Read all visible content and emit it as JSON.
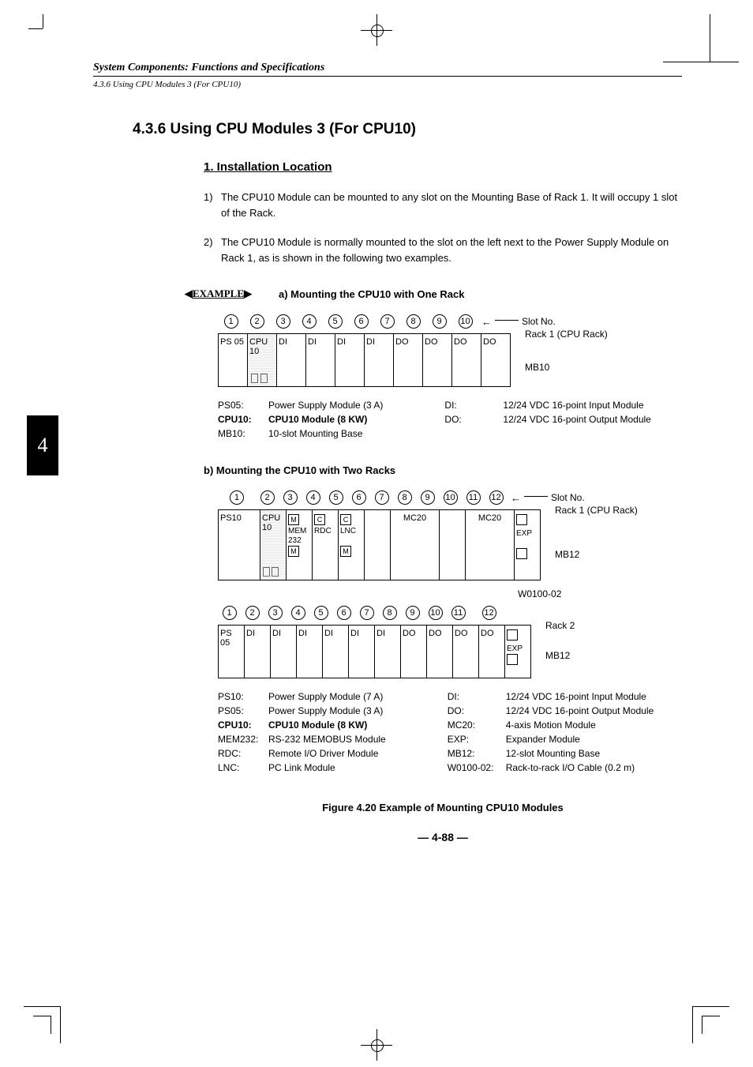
{
  "header": {
    "running": "System Components: Functions and Specifications",
    "breadcrumb": "4.3.6 Using CPU Modules 3 (For CPU10)"
  },
  "thumb": "4",
  "section": {
    "num_title": "4.3.6  Using CPU Modules 3 (For CPU10)",
    "h2": "1.  Installation Location",
    "p1_num": "1)",
    "p1": "The CPU10 Module can be mounted to any slot on the Mounting Base of Rack 1. It will occupy 1 slot of the Rack.",
    "p2_num": "2)",
    "p2": "The CPU10 Module is normally mounted to the slot on the left next to the Power Supply Module on Rack 1, as is shown in the following two examples."
  },
  "example_marker": "EXAMPLE",
  "a": {
    "title": "a)  Mounting the CPU10 with One Rack",
    "slot_no_label": "Slot No.",
    "slots": [
      "PS 05",
      "CPU 10",
      "DI",
      "DI",
      "DI",
      "DI",
      "DO",
      "DO",
      "DO",
      "DO"
    ],
    "slot_nums": [
      "1",
      "2",
      "3",
      "4",
      "5",
      "6",
      "7",
      "8",
      "9",
      "10"
    ],
    "rack_label": "Rack 1 (CPU Rack)",
    "mb_label": "MB10",
    "legend_left": [
      {
        "k": "PS05:",
        "v": "Power Supply Module (3 A)",
        "b": false
      },
      {
        "k": "CPU10:",
        "v": "CPU10 Module (8 KW)",
        "b": true
      },
      {
        "k": "MB10:",
        "v": "10-slot Mounting Base",
        "b": false
      }
    ],
    "legend_right": [
      {
        "k": "DI:",
        "v": "12/24 VDC 16-point Input Module"
      },
      {
        "k": "DO:",
        "v": "12/24 VDC 16-point Output Module"
      }
    ]
  },
  "b": {
    "title": "b)  Mounting the CPU10 with Two Racks",
    "slot_no_label": "Slot No.",
    "slot_nums": [
      "1",
      "2",
      "3",
      "4",
      "5",
      "6",
      "7",
      "8",
      "9",
      "10",
      "11",
      "12"
    ],
    "rack1_slots": [
      "PS10",
      "CPU 10",
      "MEM 232",
      "RDC",
      "LNC",
      "",
      "MC20",
      "",
      "MC20",
      "",
      "EXP"
    ],
    "rack1_label": "Rack 1 (CPU Rack)",
    "rack1_mb": "MB12",
    "cable": "W0100-02",
    "rack2_slots": [
      "PS 05",
      "DI",
      "DI",
      "DI",
      "DI",
      "DI",
      "DI",
      "DO",
      "DO",
      "DO",
      "DO",
      "EXP"
    ],
    "rack2_label": "Rack 2",
    "rack2_mb": "MB12",
    "legend_left": [
      {
        "k": "PS10:",
        "v": "Power Supply Module (7 A)",
        "b": false
      },
      {
        "k": "PS05:",
        "v": "Power Supply Module (3 A)",
        "b": false
      },
      {
        "k": "CPU10:",
        "v": "CPU10 Module (8 KW)",
        "b": true
      },
      {
        "k": "MEM232:",
        "v": "RS-232 MEMOBUS Module",
        "b": false
      },
      {
        "k": "RDC:",
        "v": "Remote I/O Driver Module",
        "b": false
      },
      {
        "k": "LNC:",
        "v": "PC Link Module",
        "b": false
      }
    ],
    "legend_right": [
      {
        "k": "DI:",
        "v": "12/24 VDC 16-point Input Module"
      },
      {
        "k": "DO:",
        "v": "12/24 VDC 16-point Output Module"
      },
      {
        "k": "MC20:",
        "v": "4-axis Motion Module"
      },
      {
        "k": "EXP:",
        "v": "Expander Module"
      },
      {
        "k": "MB12:",
        "v": "12-slot Mounting Base"
      },
      {
        "k": "W0100-02:",
        "v": "Rack-to-rack I/O Cable (0.2 m)"
      }
    ]
  },
  "caption": "Figure 4.20 Example of Mounting CPU10 Modules",
  "pagenum": "— 4-88 —",
  "icons": {
    "left_arrow": "◀",
    "right_arrow": "▶",
    "long_arrow": "←"
  }
}
